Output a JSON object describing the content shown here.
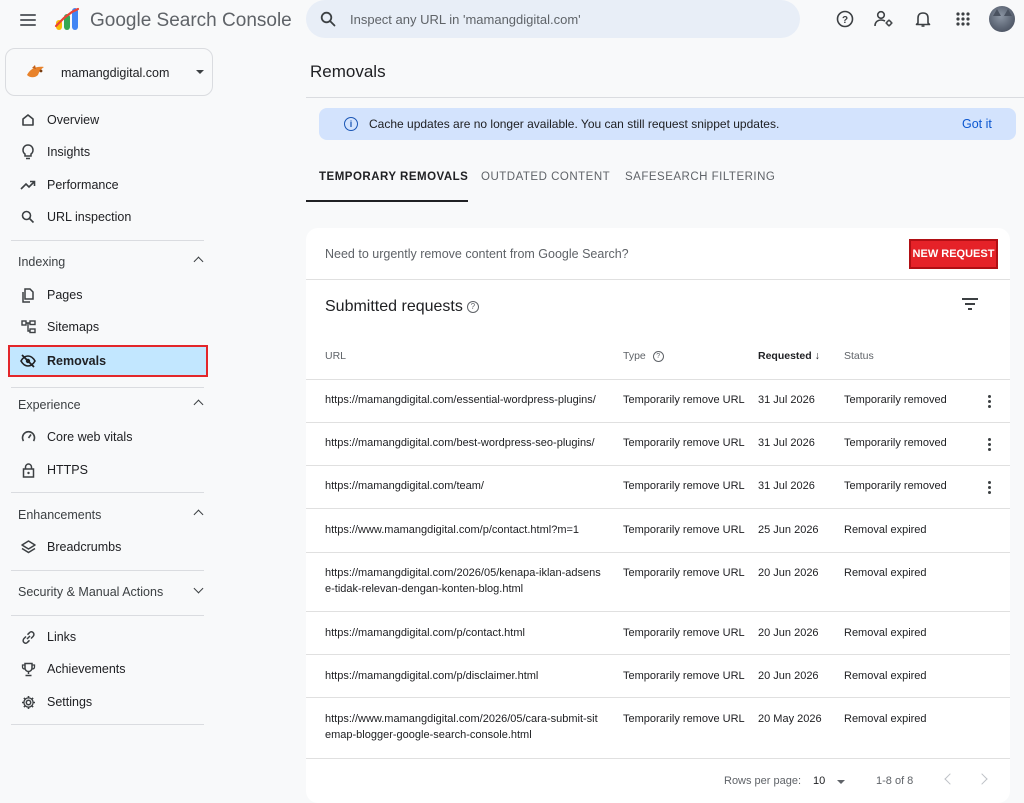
{
  "app": {
    "name": "Google Search Console"
  },
  "search": {
    "placeholder": "Inspect any URL in 'mamangdigital.com'"
  },
  "property": {
    "name": "mamangdigital.com"
  },
  "sidebar": {
    "top_items": [
      {
        "label": "Overview",
        "icon": "home-icon"
      },
      {
        "label": "Insights",
        "icon": "lightbulb-icon"
      },
      {
        "label": "Performance",
        "icon": "trending-up-icon"
      },
      {
        "label": "URL inspection",
        "icon": "search-icon"
      }
    ],
    "indexing": {
      "label": "Indexing",
      "items": [
        {
          "label": "Pages",
          "icon": "pages-icon"
        },
        {
          "label": "Sitemaps",
          "icon": "sitemap-icon"
        },
        {
          "label": "Removals",
          "icon": "visibility-off-icon"
        }
      ]
    },
    "experience": {
      "label": "Experience",
      "items": [
        {
          "label": "Core web vitals",
          "icon": "speed-icon"
        },
        {
          "label": "HTTPS",
          "icon": "lock-icon"
        }
      ]
    },
    "enhancements": {
      "label": "Enhancements",
      "items": [
        {
          "label": "Breadcrumbs",
          "icon": "layers-icon"
        }
      ]
    },
    "security": {
      "label": "Security & Manual Actions"
    },
    "bottom_items": [
      {
        "label": "Links",
        "icon": "link-icon"
      },
      {
        "label": "Achievements",
        "icon": "trophy-icon"
      },
      {
        "label": "Settings",
        "icon": "settings-icon"
      }
    ]
  },
  "main": {
    "title": "Removals",
    "banner": {
      "text": "Cache updates are no longer available. You can still request snippet updates.",
      "action": "Got it"
    },
    "tabs": [
      "TEMPORARY REMOVALS",
      "OUTDATED CONTENT",
      "SAFESEARCH FILTERING"
    ],
    "prompt": "Need to urgently remove content from Google Search?",
    "new_request": "NEW REQUEST",
    "submitted_title": "Submitted requests",
    "columns": {
      "url": "URL",
      "type": "Type",
      "requested": "Requested",
      "status": "Status"
    },
    "rows": [
      {
        "url": "https://mamangdigital.com/essential-wordpress-plugins/",
        "type": "Temporarily remove URL",
        "requested": "31 Jul 2026",
        "status": "Temporarily removed"
      },
      {
        "url": "https://mamangdigital.com/best-wordpress-seo-plugins/",
        "type": "Temporarily remove URL",
        "requested": "31 Jul 2026",
        "status": "Temporarily removed"
      },
      {
        "url": "https://mamangdigital.com/team/",
        "type": "Temporarily remove URL",
        "requested": "31 Jul 2026",
        "status": "Temporarily removed"
      },
      {
        "url": "https://www.mamangdigital.com/p/contact.html?m=1",
        "type": "Temporarily remove URL",
        "requested": "25 Jun 2026",
        "status": "Removal expired"
      },
      {
        "url_line1": "https://mamangdigital.com/2026/05/kenapa-iklan-adsens",
        "url_line2": "e-tidak-relevan-dengan-konten-blog.html",
        "type": "Temporarily remove URL",
        "requested": "20 Jun 2026",
        "status": "Removal expired"
      },
      {
        "url": "https://mamangdigital.com/p/contact.html",
        "type": "Temporarily remove URL",
        "requested": "20 Jun 2026",
        "status": "Removal expired"
      },
      {
        "url": "https://mamangdigital.com/p/disclaimer.html",
        "type": "Temporarily remove URL",
        "requested": "20 Jun 2026",
        "status": "Removal expired"
      },
      {
        "url_line1": "https://www.mamangdigital.com/2026/05/cara-submit-sit",
        "url_line2": "emap-blogger-google-search-console.html",
        "type": "Temporarily remove URL",
        "requested": "20 May 2026",
        "status": "Removal expired"
      }
    ],
    "pagination": {
      "rows_per_page_label": "Rows per page:",
      "rows_per_page": "10",
      "range": "1-8 of 8"
    }
  },
  "colors": {
    "accent": "#0b57d0",
    "active_nav": "#c2e7ff",
    "highlight_red": "#e3262a",
    "banner_bg": "#d3e3fd"
  }
}
